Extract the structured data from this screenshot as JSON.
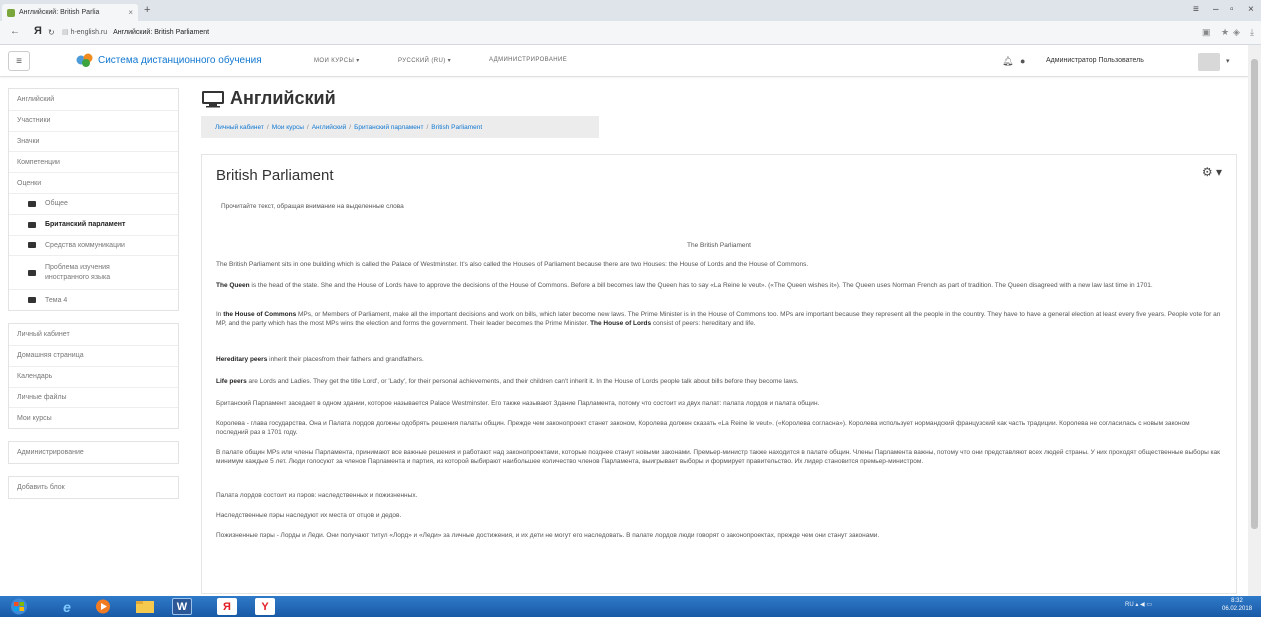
{
  "browser": {
    "tab_title": "Английский: British Parlia",
    "tab_close": "×",
    "new_tab": "+",
    "back": "←",
    "yandex": "Я",
    "domain": "h-english.ru",
    "page_title": "Английский: British Parliament"
  },
  "navbar": {
    "menu_icon": "≡",
    "site_name": "Система дистанционного обучения",
    "menu": [
      "МОИ КУРСЫ ▾",
      "РУССКИЙ (RU) ▾",
      "АДМИНИСТРИРОВАНИЕ"
    ],
    "user": "Администратор Пользователь",
    "user_caret": "▾"
  },
  "sidebar": {
    "course": [
      "Английский",
      "Участники",
      "Значки",
      "Компетенции",
      "Оценки"
    ],
    "sections": [
      "Общее",
      "Британский парламент",
      "Средства коммуникации",
      "Проблема изучения иностранного языка",
      "Тема 4"
    ],
    "general": [
      "Личный кабинет",
      "Домашняя страница",
      "Календарь",
      "Личные файлы",
      "Мои курсы"
    ],
    "admin": "Администрирование",
    "add_block": "Добавить блок"
  },
  "page": {
    "heading": "Английский",
    "breadcrumb": [
      "Личный кабинет",
      "Мои курсы",
      "Английский",
      "Британский парламент",
      "British Parliament"
    ],
    "breadcrumb_sep": "/",
    "title": "British Parliament",
    "settings_icon": "⚙ ▾",
    "intro": "Прочитайте текст, обращая внимание на выделенные слова",
    "text_title": "The British Parliament",
    "p1": "The British Parliament sits in one building which is called the Palace of Westminster. It's also called the Houses of Parliament because there are two Houses: the House of Lords and the House of Commons.",
    "p2_b": "The Queen",
    "p2": " is the head of the state. She and the House of Lords have to approve the decisions of the House of Commons. Before a bill becomes law the Queen has to say «La Reine le veut». («The Queen wishes it»). The Queen uses Norman French as part of tradition. The Queen disagreed with a new law last time in 1701.",
    "p3_pre": "In ",
    "p3_b1": "the House of Commons",
    "p3_mid": " MPs, or Members of Parliament, make all the important decisions and work on bills, which later become new laws. The Prime Minister is in the House of Commons too. MPs are important because they represent all the people in the country. They have to have a general election at least every five years. People vote for an MP, and the party which has the most MPs wins the election and forms the government. Their leader becomes the Prime Minister. ",
    "p3_b2": "The House of Lords",
    "p3_end": " consist of peers: hereditary and life.",
    "p4_b": "Hereditary peers",
    "p4": " inherit their placesfrom their fathers and grandfathers.",
    "p5_b": "Life peers",
    "p5": " are Lords and Ladies. They get the title Lord', or 'Lady', for their personal achievements, and their children can't inherit it. In the House of Lords people talk about bills before they become laws.",
    "ru1": "Британский Парламент заседает в одном здании, которое называется Palace Westminster. Его также называют Здание Парламента, потому что состоит из двух палат: палата лордов и палата общин.",
    "ru2": "Королева - глава государства. Она и Палата лордов должны одобрять решения палаты общин. Прежде чем законопроект станет законом, Королева должен сказать «La Reine le veut». («Королева согласна»). Королева использует нормандский французский как часть традиции. Королева не согласилась с новым законом последний раз в 1701 году.",
    "ru3": "В палате общин MPs или члены Парламента, принимают все важные решения и работают над законопроектами, которые позднее станут новыми законами. Премьер-министр также находится в палате общин. Члены Парламента важны, потому что они представляют всех людей страны. У них проходят общественные выборы как минимум каждые 5 лет. Люди голосуют за членов Парламента и партия, из которой выбирают наибольшее количество членов Парламента, выигрывает выборы и формирует правительство. Их лидер становится премьер-министром.",
    "ru4": "Палата лордов состоит из пэров: наследственных и пожизненных.",
    "ru5": "Наследственные пэры наследуют их места от отцов и дедов.",
    "ru6": "Пожизненные пэры - Лорды и Леди. Они получают титул «Лорд» и «Леди» за личные достижения, и их дети не могут его наследовать. В палате лордов люди говорят о законопроектах, прежде чем они станут законами."
  },
  "taskbar": {
    "yandex": "Я",
    "yandex_browser": "Y",
    "word": "W",
    "ie": "e",
    "lang": "RU",
    "time": "8:32",
    "date": "06.02.2018"
  },
  "colors": {
    "link": "#1177d1",
    "taskbar": "#2f7ac9"
  }
}
